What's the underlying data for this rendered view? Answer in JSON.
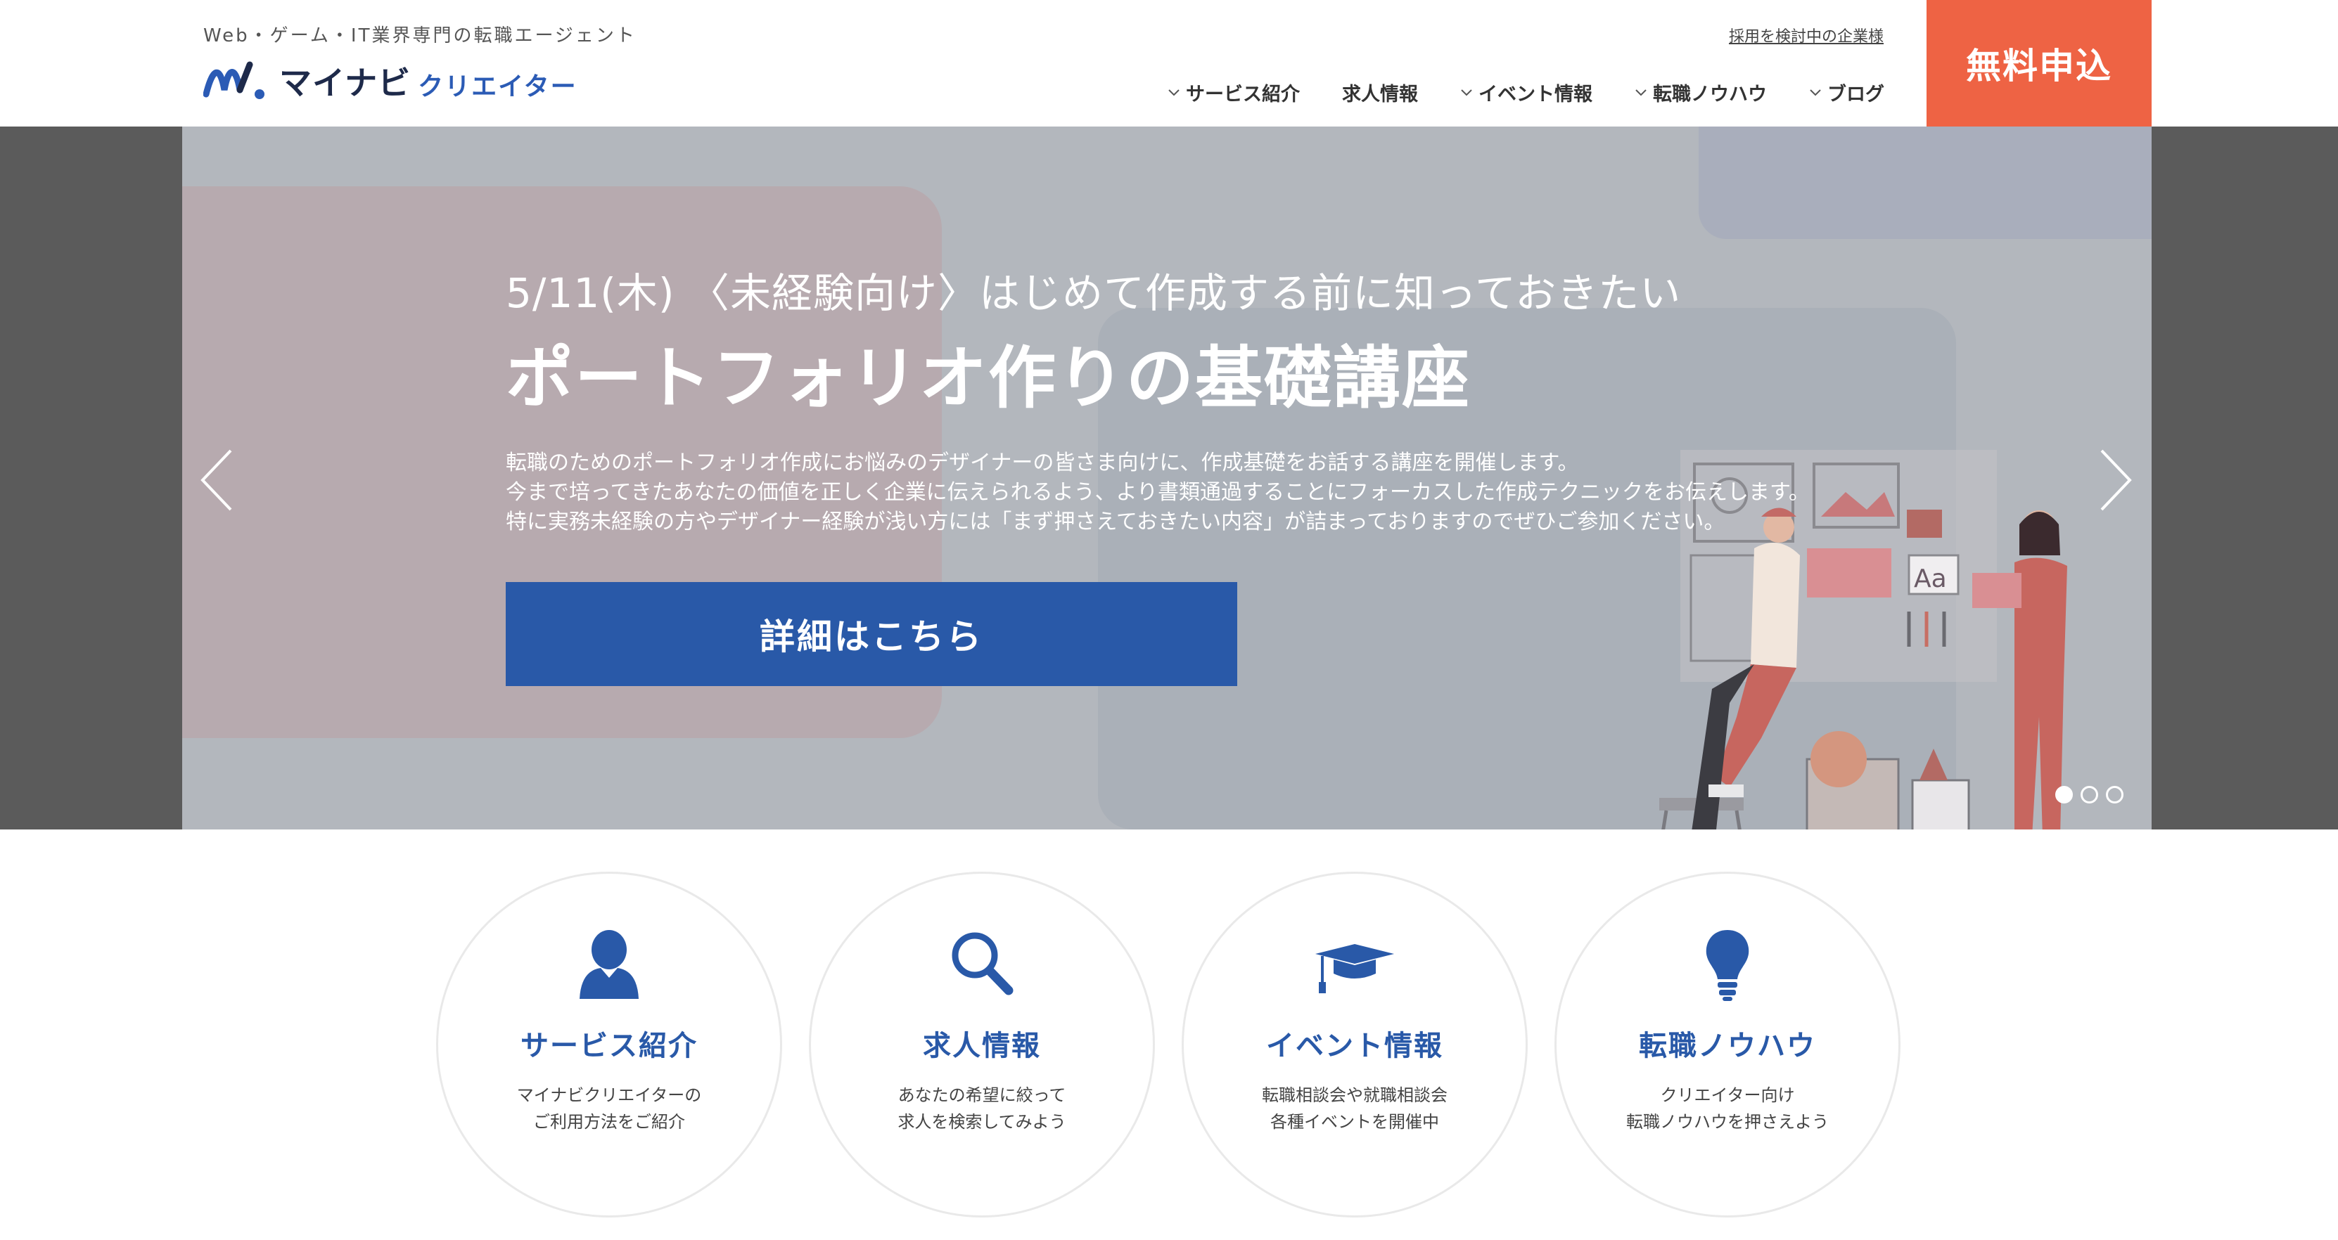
{
  "header": {
    "tagline": "Web・ゲーム・IT業界専門の転職エージェント",
    "logo_main": "マイナビ",
    "logo_sub": "クリエイター",
    "corp_link": "採用を検討中の企業様",
    "cta_label": "無料申込",
    "nav": [
      {
        "label": "サービス紹介",
        "has_dropdown": true
      },
      {
        "label": "求人情報",
        "has_dropdown": false
      },
      {
        "label": "イベント情報",
        "has_dropdown": true
      },
      {
        "label": "転職ノウハウ",
        "has_dropdown": true
      },
      {
        "label": "ブログ",
        "has_dropdown": true
      }
    ]
  },
  "hero": {
    "date_line": "5/11(木) 〈未経験向け〉はじめて作成する前に知っておきたい",
    "title": "ポートフォリオ作りの基礎講座",
    "desc_lines": [
      "転職のためのポートフォリオ作成にお悩みのデザイナーの皆さま向けに、作成基礎をお話する講座を開催します。",
      "今まで培ってきたあなたの価値を正しく企業に伝えられるよう、より書類通過することにフォーカスした作成テクニックをお伝えします。",
      "特に実務未経験の方やデザイナー経験が浅い方には「まず押さえておきたい内容」が詰まっておりますのでぜひご参加ください。"
    ],
    "button_label": "詳細はこちら",
    "slide_count": 3,
    "active_slide": 1,
    "illustration_text": "Aa"
  },
  "services": [
    {
      "title": "サービス紹介",
      "icon": "person-icon",
      "desc_lines": [
        "マイナビクリエイターの",
        "ご利用方法をご紹介"
      ]
    },
    {
      "title": "求人情報",
      "icon": "search-icon",
      "desc_lines": [
        "あなたの希望に絞って",
        "求人を検索してみよう"
      ]
    },
    {
      "title": "イベント情報",
      "icon": "graduation-cap-icon",
      "desc_lines": [
        "転職相談会や就職相談会",
        "各種イベントを開催中"
      ]
    },
    {
      "title": "転職ノウハウ",
      "icon": "lightbulb-icon",
      "desc_lines": [
        "クリエイター向け",
        "転職ノウハウを押さえよう"
      ]
    }
  ],
  "colors": {
    "brand_blue": "#2959a8",
    "cta_orange": "#ee6344",
    "hero_bg": "#b3b7bd",
    "side_dark": "#5b5b5b"
  }
}
